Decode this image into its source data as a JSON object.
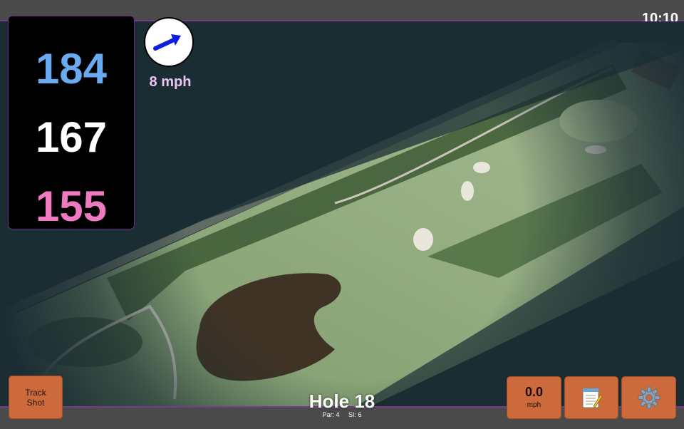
{
  "status_bar": {
    "time": "10:10"
  },
  "distances": {
    "back": "184",
    "middle": "167",
    "front": "155"
  },
  "wind": {
    "speed": "8 mph",
    "direction_icon": "arrow-icon"
  },
  "hole": {
    "title": "Hole 18",
    "par": "Par: 4",
    "stroke_index": "SI: 6"
  },
  "buttons": {
    "track_shot": {
      "line1": "Track",
      "line2": "Shot"
    },
    "speed": {
      "value": "0.0",
      "unit": "mph"
    },
    "notes_icon": "notepad-icon",
    "settings_icon": "gear-icon"
  },
  "colors": {
    "back_distance": "#6aaaf0",
    "middle_distance": "#ffffff",
    "front_distance": "#f07ac2",
    "button": "#cc6a3c",
    "accent_border": "#7a3a8a",
    "wind_arrow": "#0a1ee0"
  }
}
